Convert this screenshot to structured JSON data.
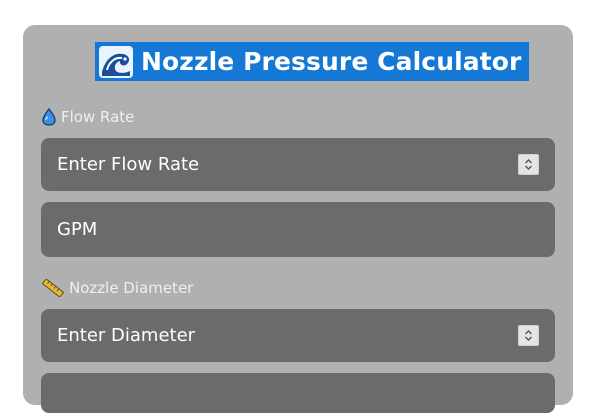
{
  "title": "Nozzle Pressure Calculator",
  "title_icon": "wave-icon",
  "fields": {
    "flow_rate": {
      "label": "Flow Rate",
      "label_icon": "droplet-icon",
      "placeholder": "Enter Flow Rate",
      "stepper_icon": "spinner-arrows-icon"
    },
    "flow_unit": {
      "value": "GPM"
    },
    "nozzle_diameter": {
      "label": "Nozzle Diameter",
      "label_icon": "ruler-icon",
      "placeholder": "Enter Diameter",
      "stepper_icon": "spinner-arrows-icon"
    }
  },
  "colors": {
    "panel": "#b0b0b0",
    "field": "#6b6b6b",
    "title_highlight": "#1478d4",
    "label": "#efefef"
  }
}
